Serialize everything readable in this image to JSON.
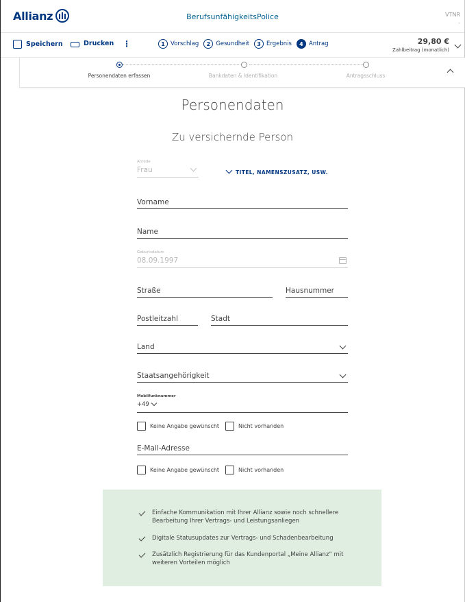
{
  "header": {
    "logo_text": "Allianz",
    "app_title": "BerufsunfähigkeitsPolice",
    "vtnr_label": "VTNR",
    "vtnr_value": "-"
  },
  "toolbar": {
    "save_label": "Speichern",
    "print_label": "Drucken",
    "more_label": "⋮",
    "steps": [
      {
        "num": "1",
        "label": "Vorschlag"
      },
      {
        "num": "2",
        "label": "Gesundheit"
      },
      {
        "num": "3",
        "label": "Ergebnis"
      },
      {
        "num": "4",
        "label": "Antrag"
      }
    ],
    "active_step": "4",
    "price": "29,80 €",
    "price_label": "Zahlbeitrag (monatlich)"
  },
  "progress": {
    "steps": [
      "Personendaten erfassen",
      "Bankdaten & Identifikation",
      "Antragsschluss"
    ],
    "active_index": 0
  },
  "main": {
    "title": "Personendaten",
    "subtitle": "Zu versichernde Person"
  },
  "form": {
    "anrede_label": "Anrede",
    "anrede_value": "Frau",
    "title_link": "TITEL, NAMENSZUSATZ, USW.",
    "vorname": "Vorname",
    "name": "Name",
    "birth_label": "Geburtsdatum",
    "birth_value": "08.09.1997",
    "street": "Straße",
    "house": "Hausnummer",
    "zip": "Postleitzahl",
    "city": "Stadt",
    "country": "Land",
    "nationality": "Staatsangehörigkeit",
    "mobile_label": "Mobilfunknummer",
    "mobile_prefix": "+49",
    "no_info": "Keine Angabe gewünscht",
    "not_available": "Nicht vorhanden",
    "email": "E-Mail-Adresse"
  },
  "info": {
    "items": [
      "Einfache Kommunikation mit Ihrer Allianz sowie noch schnellere Bearbeitung Ihrer Vertrags- und Leistungsanliegen",
      "Digitale Statusupdates zur Vertrags- und Schadenbearbeitung",
      "Zusätzlich Registrierung für das Kundenportal „Meine Allianz“ mit weiteren Vorteilen möglich"
    ]
  },
  "colors": {
    "brand": "#003781",
    "info_bg": "#e0eee2",
    "text": "#414141"
  }
}
